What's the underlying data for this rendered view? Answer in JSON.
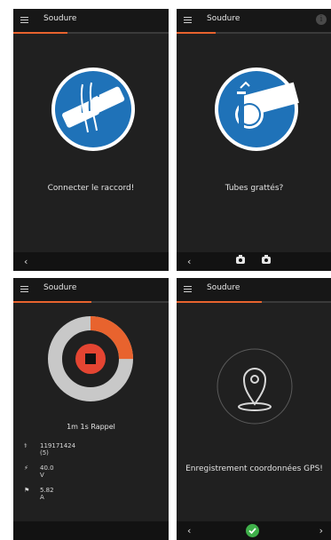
{
  "app": {
    "title": "Soudure"
  },
  "screens": [
    {
      "step": "connect",
      "message": "Connecter le raccord!",
      "progress": 0.35,
      "back_glyph": "‹",
      "icon": "pipe-coupler-icon",
      "accent": "#1f72b8"
    },
    {
      "step": "scrape",
      "message": "Tubes grattés?",
      "progress": 0.25,
      "info_glyph": "i",
      "back_glyph": "‹",
      "actions": [
        "camera-icon",
        "camera-icon"
      ],
      "icon": "pipe-scraper-icon",
      "accent": "#1f72b8"
    },
    {
      "step": "welding",
      "status": "1m 1s Rappel",
      "progress": 0.5,
      "weld_progress": 0.25,
      "readings": {
        "counter": "119171424 (5)",
        "voltage": "40.0 V",
        "current": "5.82 A"
      },
      "accent": "#e8632e",
      "track": "#c8c8c8"
    },
    {
      "step": "gps",
      "message": "Enregistrement coordonnées GPS!",
      "progress": 0.55,
      "back_glyph": "‹",
      "forward_glyph": "›",
      "icon": "map-pin-icon",
      "confirm": "#3fb04a"
    }
  ]
}
